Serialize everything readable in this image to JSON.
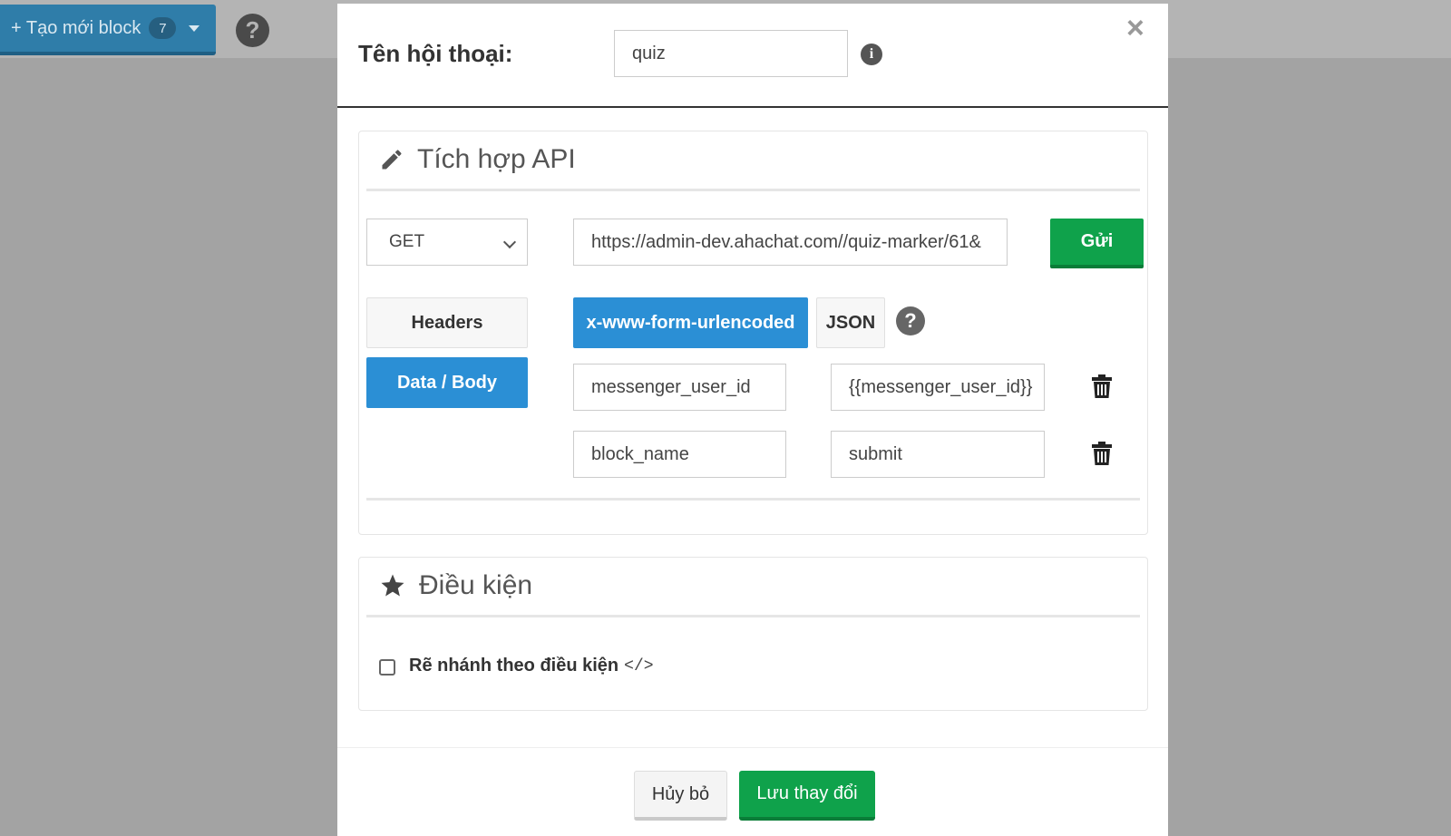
{
  "app": {
    "create_block_label": "+ Tạo mới block",
    "create_block_count": "7",
    "help_glyph": "?"
  },
  "modal": {
    "conversation_label": "Tên hội thoại:",
    "conversation_value": "quiz",
    "info_glyph": "i",
    "close_glyph": "×",
    "api": {
      "title": "Tích hợp API",
      "method": "GET",
      "url": "https://admin-dev.ahachat.com//quiz-marker/61&",
      "send_label": "Gửi",
      "tabs": {
        "headers": "Headers",
        "body": "Data / Body"
      },
      "encodings": {
        "form": "x-www-form-urlencoded",
        "json": "JSON",
        "help_glyph": "?"
      },
      "params": [
        {
          "key": "messenger_user_id",
          "value": "{{messenger_user_id}}"
        },
        {
          "key": "block_name",
          "value": "submit"
        }
      ]
    },
    "conditions": {
      "title": "Điều kiện",
      "branch_label": "Rẽ nhánh theo điều kiện",
      "branch_code": "</>",
      "branch_checked": false
    },
    "footer": {
      "cancel_label": "Hủy bỏ",
      "save_label": "Lưu thay đổi"
    }
  },
  "colors": {
    "primary_blue": "#2b8fd5",
    "success_green": "#0fa24b",
    "overlay_gray": "#a3a3a3"
  },
  "icons": [
    "help-icon",
    "info-icon",
    "close-icon",
    "pencil-icon",
    "star-icon",
    "trash-icon",
    "chevron-down-icon"
  ]
}
